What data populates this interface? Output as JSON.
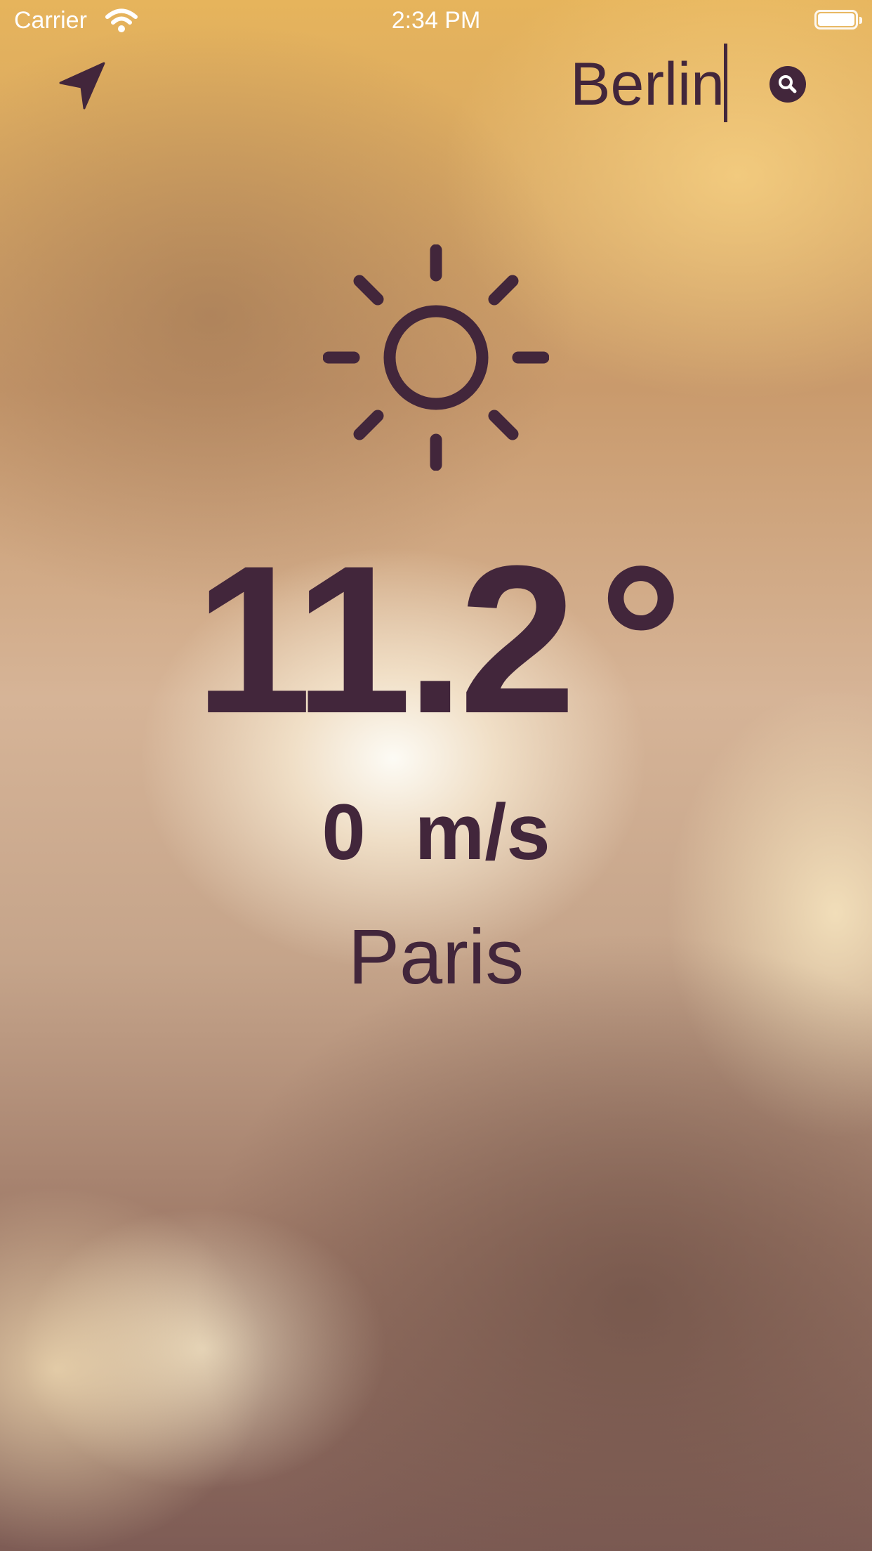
{
  "status_bar": {
    "carrier": "Carrier",
    "time": "2:34 PM"
  },
  "search": {
    "value": "Berlin"
  },
  "weather": {
    "icon": "sun-icon",
    "temperature": "11.2",
    "degree_symbol": "°",
    "wind_speed": "0",
    "wind_unit": "m/s",
    "city": "Paris"
  },
  "colors": {
    "text": "#42263b",
    "status_text": "#ffffff"
  }
}
